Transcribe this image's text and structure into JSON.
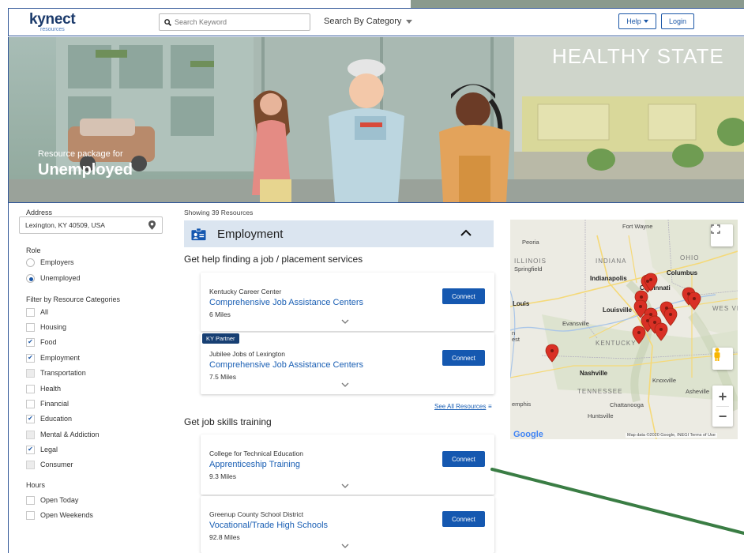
{
  "header": {
    "logo_main": "kynect",
    "logo_sub": "resources",
    "search_placeholder": "Search Keyword",
    "category_label": "Search By Category",
    "help_label": "Help",
    "login_label": "Login"
  },
  "hero": {
    "subtitle": "Resource package for",
    "title": "Unemployed",
    "sign_text": "HEALTHY STATE"
  },
  "filters": {
    "address_label": "Address",
    "address_value": "Lexington, KY 40509, USA",
    "role_label": "Role",
    "roles": [
      {
        "label": "Employers",
        "selected": false
      },
      {
        "label": "Unemployed",
        "selected": true
      }
    ],
    "categories_label": "Filter by Resource Categories",
    "categories": [
      {
        "label": "All",
        "state": "empty"
      },
      {
        "label": "Housing",
        "state": "empty"
      },
      {
        "label": "Food",
        "state": "checked"
      },
      {
        "label": "Employment",
        "state": "checked"
      },
      {
        "label": "Transportation",
        "state": "disabled"
      },
      {
        "label": "Health",
        "state": "empty"
      },
      {
        "label": "Financial",
        "state": "empty"
      },
      {
        "label": "Education",
        "state": "checked"
      },
      {
        "label": "Mental & Addiction",
        "state": "disabled"
      },
      {
        "label": "Legal",
        "state": "checked"
      },
      {
        "label": "Consumer",
        "state": "disabled"
      }
    ],
    "hours_label": "Hours",
    "hours": [
      {
        "label": "Open Today"
      },
      {
        "label": "Open Weekends"
      }
    ]
  },
  "results": {
    "showing": "Showing 39 Resources",
    "section_title": "Employment",
    "group1_title": "Get help finding a job / placement services",
    "group2_title": "Get job skills training",
    "see_all": "See All Resources",
    "partner_badge": "KY Partner",
    "connect_label": "Connect",
    "cards": [
      {
        "org": "Kentucky Career Center",
        "service": "Comprehensive Job Assistance Centers",
        "distance": "6 Miles"
      },
      {
        "org": "Jubilee Jobs of Lexington",
        "service": "Comprehensive Job Assistance Centers",
        "distance": "7.5 Miles"
      },
      {
        "org": "College for Technical Education",
        "service": "Apprenticeship Training",
        "distance": "9.3 Miles"
      },
      {
        "org": "Greenup County School District",
        "service": "Vocational/Trade High Schools",
        "distance": "92.8 Miles"
      }
    ]
  },
  "map": {
    "labels": {
      "fort_wayne": "Fort Wayne",
      "peoria": "Peoria",
      "illinois": "ILLINOIS",
      "springfield": "Springfield",
      "indiana": "INDIANA",
      "ohio": "OHIO",
      "columbus": "Columbus",
      "indianapolis": "Indianapolis",
      "cincinnati": "Cincinnati",
      "louis": "Louis",
      "louisville": "Louisville",
      "evansville": "Evansville",
      "west_virginia": "WES VIRGI",
      "kentucky": "KENTUCKY",
      "nashville": "Nashville",
      "knoxville": "Knoxville",
      "asheville": "Asheville",
      "tennessee": "TENNESSEE",
      "memphis": "emphis",
      "chattanooga": "Chattanooga",
      "huntsville": "Huntsville",
      "west": "n est"
    },
    "google": "Google",
    "attribution": "Map data ©2020 Google, INEGI   Terms of Use",
    "zoom_in": "+",
    "zoom_out": "−"
  },
  "colors": {
    "brand_blue": "#1558b0",
    "link_blue": "#1a5fb4",
    "accordion_bg": "#dbe5f0",
    "badge_bg": "#173f73",
    "annotation_arrow": "#3a7d44"
  }
}
